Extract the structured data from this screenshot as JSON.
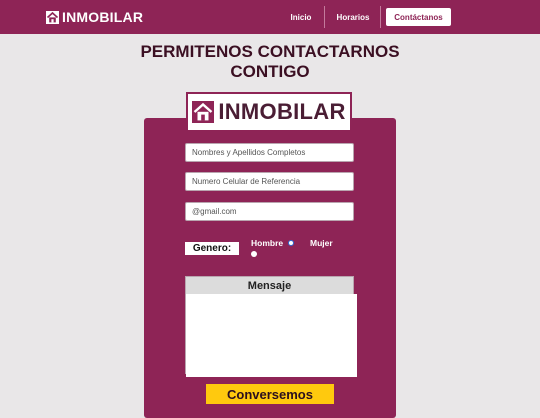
{
  "nav": {
    "brand": "INMOBILAR",
    "brand_icon": "house-logo-icon",
    "items": [
      {
        "label": "Inicio",
        "active": false
      },
      {
        "label": "Horarios",
        "active": false
      },
      {
        "label": "Contáctanos",
        "active": true
      }
    ]
  },
  "page": {
    "title_line1": "PERMITENOS CONTACTARNOS",
    "title_line2": "CONTIGO"
  },
  "form": {
    "logo_text": "INMOBILAR",
    "name_placeholder": "Nombres y Apellidos Completos",
    "phone_placeholder": "Numero Celular de Referencia",
    "email_placeholder": "@gmail.com",
    "gender_label": "Genero:",
    "gender_options": [
      {
        "label": "Hombre",
        "checked": true
      },
      {
        "label": "Mujer",
        "checked": false
      }
    ],
    "message_label": "Mensaje",
    "submit_label": "Conversemos"
  },
  "colors": {
    "primary": "#8e2456",
    "background": "#e9e7e8",
    "accent": "#ffc90e"
  }
}
